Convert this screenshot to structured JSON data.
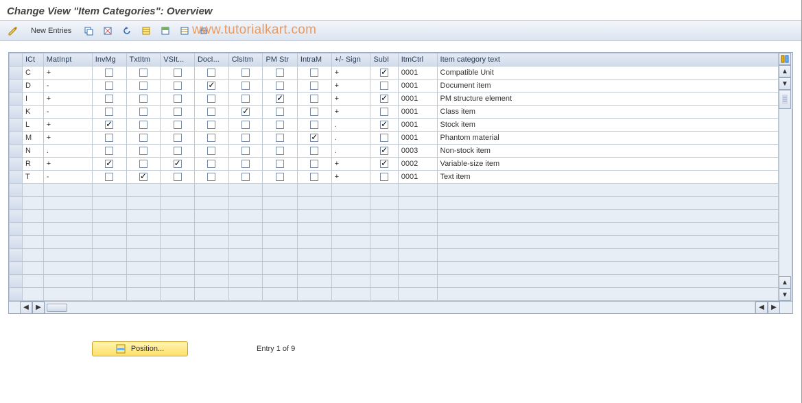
{
  "page": {
    "title": "Change View \"Item Categories\": Overview"
  },
  "toolbar": {
    "new_entries": "New Entries"
  },
  "watermark": "www.tutorialkart.com",
  "columns": [
    "ICt",
    "MatInpt",
    "InvMg",
    "TxtItm",
    "VSIt...",
    "DocI...",
    "ClsItm",
    "PM Str",
    "IntraM",
    "+/- Sign",
    "SubI",
    "ItmCtrl",
    "Item category text"
  ],
  "rows": [
    {
      "ict": "C",
      "mat": "+",
      "inv": false,
      "txt": false,
      "vsi": false,
      "doc": false,
      "cls": false,
      "pms": false,
      "intr": false,
      "sign": "+",
      "subi": true,
      "ctrl": "0001",
      "text": "Compatible Unit"
    },
    {
      "ict": "D",
      "mat": "-",
      "inv": false,
      "txt": false,
      "vsi": false,
      "doc": true,
      "cls": false,
      "pms": false,
      "intr": false,
      "sign": "+",
      "subi": false,
      "ctrl": "0001",
      "text": "Document item"
    },
    {
      "ict": "I",
      "mat": "+",
      "inv": false,
      "txt": false,
      "vsi": false,
      "doc": false,
      "cls": false,
      "pms": true,
      "intr": false,
      "sign": "+",
      "subi": true,
      "ctrl": "0001",
      "text": "PM structure element"
    },
    {
      "ict": "K",
      "mat": "-",
      "inv": false,
      "txt": false,
      "vsi": false,
      "doc": false,
      "cls": true,
      "pms": false,
      "intr": false,
      "sign": "+",
      "subi": false,
      "ctrl": "0001",
      "text": "Class item"
    },
    {
      "ict": "L",
      "mat": "+",
      "inv": true,
      "txt": false,
      "vsi": false,
      "doc": false,
      "cls": false,
      "pms": false,
      "intr": false,
      "sign": ".",
      "subi": true,
      "ctrl": "0001",
      "text": "Stock item"
    },
    {
      "ict": "M",
      "mat": "+",
      "inv": false,
      "txt": false,
      "vsi": false,
      "doc": false,
      "cls": false,
      "pms": false,
      "intr": true,
      "sign": ".",
      "subi": false,
      "ctrl": "0001",
      "text": "Phantom material"
    },
    {
      "ict": "N",
      "mat": ".",
      "inv": false,
      "txt": false,
      "vsi": false,
      "doc": false,
      "cls": false,
      "pms": false,
      "intr": false,
      "sign": ".",
      "subi": true,
      "ctrl": "0003",
      "text": "Non-stock item"
    },
    {
      "ict": "R",
      "mat": "+",
      "inv": true,
      "txt": false,
      "vsi": true,
      "doc": false,
      "cls": false,
      "pms": false,
      "intr": false,
      "sign": "+",
      "subi": true,
      "ctrl": "0002",
      "text": "Variable-size item"
    },
    {
      "ict": "T",
      "mat": "-",
      "inv": false,
      "txt": true,
      "vsi": false,
      "doc": false,
      "cls": false,
      "pms": false,
      "intr": false,
      "sign": "+",
      "subi": false,
      "ctrl": "0001",
      "text": "Text item"
    }
  ],
  "empty_rows": 9,
  "footer": {
    "position_label": "Position...",
    "entry_text": "Entry 1 of 9"
  },
  "icons": {
    "configure": "configure-columns-icon"
  }
}
